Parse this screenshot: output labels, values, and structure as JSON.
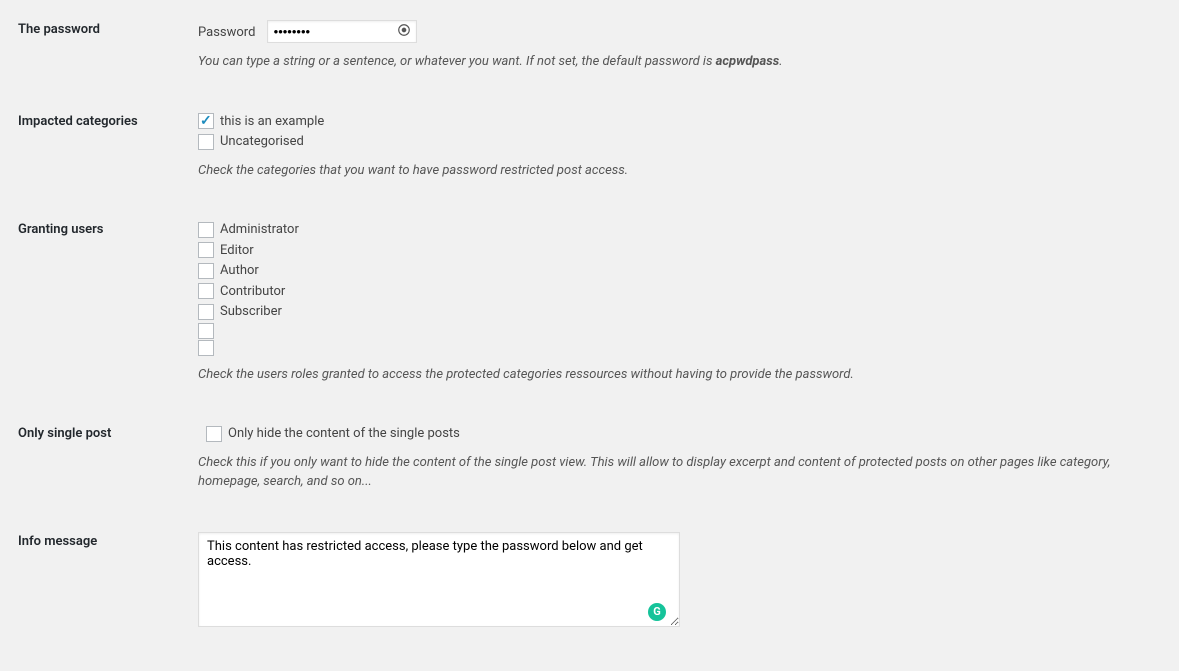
{
  "password": {
    "th": "The password",
    "inline_label": "Password",
    "value": "••••••••",
    "description_prefix": "You can type a string or a sentence, or whatever you want. If not set, the default password is ",
    "default_password": "acpwdpass",
    "description_suffix": "."
  },
  "categories": {
    "th": "Impacted categories",
    "items": [
      {
        "label": "this is an example",
        "checked": true
      },
      {
        "label": "Uncategorised",
        "checked": false
      }
    ],
    "description": "Check the categories that you want to have password restricted post access."
  },
  "granting": {
    "th": "Granting users",
    "items": [
      {
        "label": "Administrator",
        "checked": false
      },
      {
        "label": "Editor",
        "checked": false
      },
      {
        "label": "Author",
        "checked": false
      },
      {
        "label": "Contributor",
        "checked": false
      },
      {
        "label": "Subscriber",
        "checked": false
      },
      {
        "label": "",
        "checked": false
      },
      {
        "label": "",
        "checked": false
      }
    ],
    "description": "Check the users roles granted to access the protected categories ressources without having to provide the password."
  },
  "single_post": {
    "th": "Only single post",
    "label": "Only hide the content of the single posts",
    "checked": false,
    "description": "Check this if you only want to hide the content of the single post view. This will allow to display excerpt and content of protected posts on other pages like category, homepage, search, and so on..."
  },
  "info_message": {
    "th": "Info message",
    "value": "This content has restricted access, please type the password below and get access."
  }
}
